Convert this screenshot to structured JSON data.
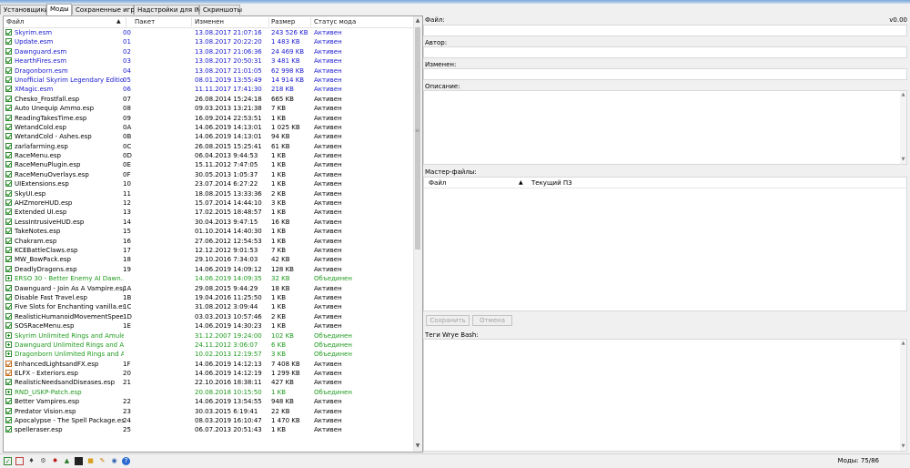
{
  "tabs": [
    {
      "label": "Установщики"
    },
    {
      "label": "Моды"
    },
    {
      "label": "Сохраненные игры"
    },
    {
      "label": "Надстройки для INI"
    },
    {
      "label": "Скриншоты"
    }
  ],
  "mods_table": {
    "headers": {
      "file": "Файл",
      "sort_arrow": "▲",
      "package": "Пакет",
      "modified": "Изменен",
      "size": "Размер",
      "status": "Статус мода"
    },
    "rows": [
      {
        "name": "Skyrim.esm",
        "order": "00",
        "date": "13.08.2017 21:07:16",
        "size": "243 526 KB",
        "status": "Активен",
        "style": "blue",
        "icon": "check"
      },
      {
        "name": "Update.esm",
        "order": "01",
        "date": "13.08.2017 20:22:20",
        "size": "1 483 KB",
        "status": "Активен",
        "style": "blue",
        "icon": "check"
      },
      {
        "name": "Dawnguard.esm",
        "order": "02",
        "date": "13.08.2017 21:06:36",
        "size": "24 469 KB",
        "status": "Активен",
        "style": "blue",
        "icon": "check"
      },
      {
        "name": "HearthFires.esm",
        "order": "03",
        "date": "13.08.2017 20:50:31",
        "size": "3 481 KB",
        "status": "Активен",
        "style": "blue",
        "icon": "check"
      },
      {
        "name": "Dragonborn.esm",
        "order": "04",
        "date": "13.08.2017 21:01:05",
        "size": "62 998 KB",
        "status": "Активен",
        "style": "blue",
        "icon": "check"
      },
      {
        "name": "Unofficial Skyrim Legendary Editio...",
        "order": "05",
        "date": "08.01.2019 13:55:49",
        "size": "14 914 KB",
        "status": "Активен",
        "style": "blue",
        "icon": "check"
      },
      {
        "name": "XMagic.esm",
        "order": "06",
        "date": "11.11.2017 17:41:30",
        "size": "218 KB",
        "status": "Активен",
        "style": "blue",
        "icon": "check"
      },
      {
        "name": "Chesko_Frostfall.esp",
        "order": "07",
        "date": "26.08.2014 15:24:18",
        "size": "665 KB",
        "status": "Активен",
        "style": "normal",
        "icon": "check"
      },
      {
        "name": "Auto Unequip Ammo.esp",
        "order": "08",
        "date": "09.03.2013 13:21:38",
        "size": "7 KB",
        "status": "Активен",
        "style": "normal",
        "icon": "check"
      },
      {
        "name": "ReadingTakesTime.esp",
        "order": "09",
        "date": "16.09.2014 22:53:51",
        "size": "1 KB",
        "status": "Активен",
        "style": "normal",
        "icon": "check"
      },
      {
        "name": "WetandCold.esp",
        "order": "0A",
        "date": "14.06.2019 14:13:01",
        "size": "1 025 KB",
        "status": "Активен",
        "style": "normal",
        "icon": "check"
      },
      {
        "name": "WetandCold - Ashes.esp",
        "order": "0B",
        "date": "14.06.2019 14:13:01",
        "size": "94 KB",
        "status": "Активен",
        "style": "normal",
        "icon": "check"
      },
      {
        "name": "zarlafarming.esp",
        "order": "0C",
        "date": "26.08.2015 15:25:41",
        "size": "61 KB",
        "status": "Активен",
        "style": "normal",
        "icon": "check"
      },
      {
        "name": "RaceMenu.esp",
        "order": "0D",
        "date": "06.04.2013 9:44:53",
        "size": "1 KB",
        "status": "Активен",
        "style": "normal",
        "icon": "check"
      },
      {
        "name": "RaceMenuPlugin.esp",
        "order": "0E",
        "date": "15.11.2012 7:47:05",
        "size": "1 KB",
        "status": "Активен",
        "style": "normal",
        "icon": "check"
      },
      {
        "name": "RaceMenuOverlays.esp",
        "order": "0F",
        "date": "30.05.2013 1:05:37",
        "size": "1 KB",
        "status": "Активен",
        "style": "normal",
        "icon": "check"
      },
      {
        "name": "UIExtensions.esp",
        "order": "10",
        "date": "23.07.2014 6:27:22",
        "size": "1 KB",
        "status": "Активен",
        "style": "normal",
        "icon": "check"
      },
      {
        "name": "SkyUI.esp",
        "order": "11",
        "date": "18.08.2015 13:33:36",
        "size": "2 KB",
        "status": "Активен",
        "style": "normal",
        "icon": "check"
      },
      {
        "name": "AHZmoreHUD.esp",
        "order": "12",
        "date": "15.07.2014 14:44:10",
        "size": "3 KB",
        "status": "Активен",
        "style": "normal",
        "icon": "check"
      },
      {
        "name": "Extended UI.esp",
        "order": "13",
        "date": "17.02.2015 18:48:57",
        "size": "1 KB",
        "status": "Активен",
        "style": "normal",
        "icon": "check"
      },
      {
        "name": "LessIntrusiveHUD.esp",
        "order": "14",
        "date": "30.04.2013 9:47:15",
        "size": "16 KB",
        "status": "Активен",
        "style": "normal",
        "icon": "check"
      },
      {
        "name": "TakeNotes.esp",
        "order": "15",
        "date": "01.10.2014 14:40:30",
        "size": "1 KB",
        "status": "Активен",
        "style": "normal",
        "icon": "check"
      },
      {
        "name": "Chakram.esp",
        "order": "16",
        "date": "27.06.2012 12:54:53",
        "size": "1 KB",
        "status": "Активен",
        "style": "normal",
        "icon": "check"
      },
      {
        "name": "KCEBattleClaws.esp",
        "order": "17",
        "date": "12.12.2012 9:01:53",
        "size": "7 KB",
        "status": "Активен",
        "style": "normal",
        "icon": "check"
      },
      {
        "name": "MW_BowPack.esp",
        "order": "18",
        "date": "29.10.2016 7:34:03",
        "size": "42 KB",
        "status": "Активен",
        "style": "normal",
        "icon": "check"
      },
      {
        "name": "DeadlyDragons.esp",
        "order": "19",
        "date": "14.06.2019 14:09:12",
        "size": "128 KB",
        "status": "Активен",
        "style": "normal",
        "icon": "check"
      },
      {
        "name": "ERSO 30 - Better Enemy AI Dawn...",
        "order": "",
        "date": "14.06.2019 14:09:35",
        "size": "32 KB",
        "status": "Объединен",
        "style": "green",
        "icon": "plus"
      },
      {
        "name": "Dawnguard - Join As A Vampire.esp",
        "order": "1A",
        "date": "29.08.2015 9:44:29",
        "size": "18 KB",
        "status": "Активен",
        "style": "normal",
        "icon": "check"
      },
      {
        "name": "Disable Fast Travel.esp",
        "order": "1B",
        "date": "19.04.2016 11:25:50",
        "size": "1 KB",
        "status": "Активен",
        "style": "normal",
        "icon": "check"
      },
      {
        "name": "Five Slots for Enchanting vanilla.esp",
        "order": "1C",
        "date": "31.08.2012 3:09:44",
        "size": "1 KB",
        "status": "Активен",
        "style": "normal",
        "icon": "check"
      },
      {
        "name": "RealisticHumanoidMovementSpee...",
        "order": "1D",
        "date": "03.03.2013 10:57:46",
        "size": "2 KB",
        "status": "Активен",
        "style": "normal",
        "icon": "check"
      },
      {
        "name": "SOSRaceMenu.esp",
        "order": "1E",
        "date": "14.06.2019 14:30:23",
        "size": "1 KB",
        "status": "Активен",
        "style": "normal",
        "icon": "check"
      },
      {
        "name": "Skyrim Unlimited Rings and Amulet...",
        "order": "",
        "date": "31.12.2007 19:24:00",
        "size": "102 KB",
        "status": "Объединен",
        "style": "green",
        "icon": "plus"
      },
      {
        "name": "Dawnguard Unlimited Rings and A...",
        "order": "",
        "date": "24.11.2012 3:06:07",
        "size": "6 KB",
        "status": "Объединен",
        "style": "green",
        "icon": "plus"
      },
      {
        "name": "Dragonborn Unlimited Rings and A...",
        "order": "",
        "date": "10.02.2013 12:19:57",
        "size": "3 KB",
        "status": "Объединен",
        "style": "green",
        "icon": "plus"
      },
      {
        "name": "EnhancedLightsandFX.esp",
        "order": "1F",
        "date": "14.06.2019 14:12:13",
        "size": "7 408 KB",
        "status": "Активен",
        "style": "normal",
        "icon": "warn"
      },
      {
        "name": "ELFX - Exteriors.esp",
        "order": "20",
        "date": "14.06.2019 14:12:19",
        "size": "1 299 KB",
        "status": "Активен",
        "style": "normal",
        "icon": "warn"
      },
      {
        "name": "RealisticNeedsandDiseases.esp",
        "order": "21",
        "date": "22.10.2016 18:38:11",
        "size": "427 KB",
        "status": "Активен",
        "style": "normal",
        "icon": "check"
      },
      {
        "name": "RND_USKP-Patch.esp",
        "order": "",
        "date": "20.08.2018 10:15:50",
        "size": "1 KB",
        "status": "Объединен",
        "style": "green",
        "icon": "plus"
      },
      {
        "name": "Better Vampires.esp",
        "order": "22",
        "date": "14.06.2019 13:54:55",
        "size": "948 KB",
        "status": "Активен",
        "style": "normal",
        "icon": "check"
      },
      {
        "name": "Predator Vision.esp",
        "order": "23",
        "date": "30.03.2015 6:19:41",
        "size": "22 KB",
        "status": "Активен",
        "style": "normal",
        "icon": "check"
      },
      {
        "name": "Apocalypse - The Spell Package.esp",
        "order": "24",
        "date": "08.03.2019 16:10:47",
        "size": "1 470 KB",
        "status": "Активен",
        "style": "normal",
        "icon": "check"
      },
      {
        "name": "spelleraser.esp",
        "order": "25",
        "date": "06.07.2013 20:51:43",
        "size": "1 KB",
        "status": "Активен",
        "style": "normal",
        "icon": "check"
      }
    ]
  },
  "details": {
    "file_label": "Файл:",
    "version": "v0.00",
    "author_label": "Автор:",
    "modified_label": "Изменен:",
    "description_label": "Описание:",
    "masters_label": "Мастер-файлы:",
    "masters_headers": {
      "file": "Файл",
      "sort_arrow": "▲",
      "current": "Текущий ПЗ"
    },
    "save_button": "Сохранить",
    "cancel_button": "Отмена",
    "tags_label": "Теги Wrye Bash:"
  },
  "statusbar": {
    "mods_count": "Моды: 75/86",
    "icons": [
      "checkbox-icon",
      "square-icon",
      "settings-icon",
      "gear-icon",
      "star-icon",
      "game-icon",
      "mail-icon",
      "folder-icon",
      "edit-icon",
      "globe-icon",
      "help-icon"
    ]
  }
}
